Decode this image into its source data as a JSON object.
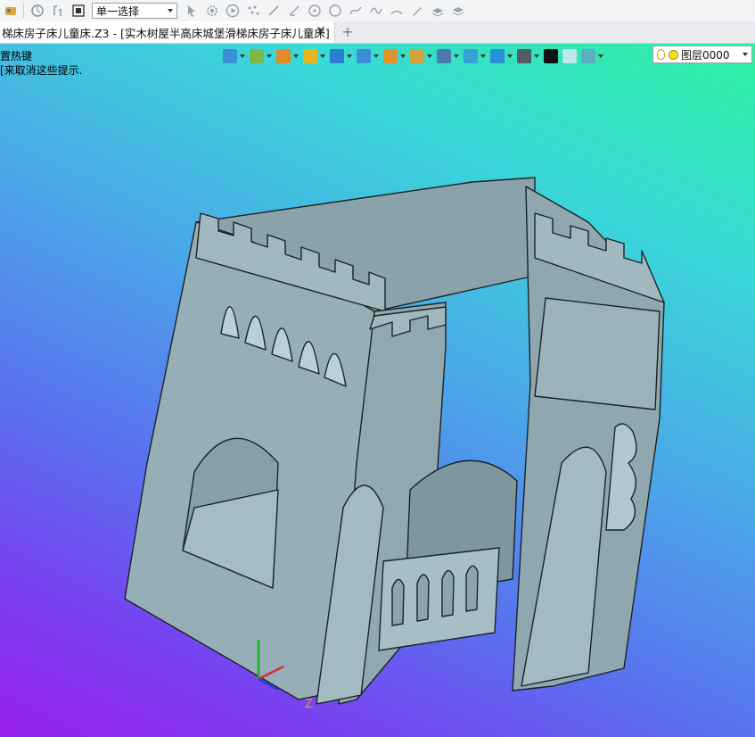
{
  "toolbar": {
    "selection_mode": "单一选择",
    "icons": [
      "app-icon",
      "rotate-icon",
      "pan-icon",
      "stop-icon",
      "pointer-icon",
      "gear-pick-icon",
      "play-icon",
      "points-icon",
      "line-icon",
      "line-angled-icon",
      "circle-center-icon",
      "circle-icon",
      "spline-icon",
      "curve-icon",
      "arc-icon",
      "pen-icon",
      "layer-stack-icon",
      "layer-stack-2-icon"
    ]
  },
  "tab": {
    "title": "梯床房子床儿童床.Z3 - [实木树屋半高床城堡滑梯床房子床儿童床]",
    "close_glyph": "✕",
    "add_glyph": "+"
  },
  "viewport": {
    "hint_1": "置热键",
    "hint_2": "[来取消这些提示.",
    "axis_z": "Z",
    "layer": {
      "name": "图层0000"
    },
    "view_tools": [
      {
        "name": "exit-icon",
        "color": "#3a8fd6"
      },
      {
        "name": "filter-icon",
        "color": "#7bb84a"
      },
      {
        "name": "pencil-icon",
        "color": "#e08a2a"
      },
      {
        "name": "shading-icon",
        "color": "#e5b622"
      },
      {
        "name": "cube-icon",
        "color": "#2a7fd0"
      },
      {
        "name": "views-icon",
        "color": "#3a8fd6"
      },
      {
        "name": "render-icon",
        "color": "#e0952a"
      },
      {
        "name": "display-icon",
        "color": "#d1a23a"
      },
      {
        "name": "axis-icon",
        "color": "#4a7ab0"
      },
      {
        "name": "frame-icon",
        "color": "#3a9fd6"
      },
      {
        "name": "dimension-icon",
        "color": "#2a8fd6"
      },
      {
        "name": "monitor-icon",
        "color": "#555c66"
      },
      {
        "name": "line-color-icon",
        "color": "#111111"
      },
      {
        "name": "fill-color-icon",
        "color": "#bfe8ec"
      },
      {
        "name": "layers-icon",
        "color": "#5ab0c0"
      }
    ]
  },
  "colors": {
    "model_face": "#96aeb6",
    "model_dark": "#7f979f",
    "model_edge": "#1c2226"
  }
}
